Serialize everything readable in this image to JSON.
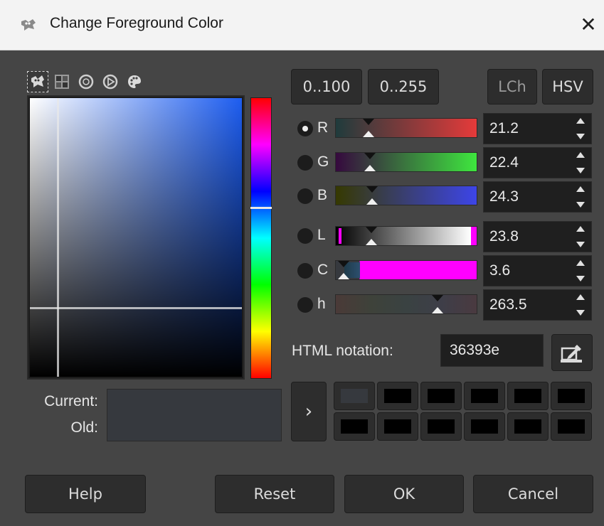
{
  "window": {
    "title": "Change Foreground Color",
    "close_symbol": "✕"
  },
  "selector_tabs": [
    {
      "icon": "gimp-wilber-icon",
      "active": true
    },
    {
      "icon": "cmyk-grid-icon",
      "active": false
    },
    {
      "icon": "color-wheel-icon",
      "active": false
    },
    {
      "icon": "triangle-wheel-icon",
      "active": false
    },
    {
      "icon": "palette-icon",
      "active": false
    }
  ],
  "range_buttons": {
    "r100": "0..100",
    "r255": "0..255"
  },
  "mode_buttons": {
    "lch": "LCh",
    "hsv": "HSV"
  },
  "channels": [
    {
      "key": "R",
      "value": "21.2",
      "selected": true,
      "fraction": 0.212,
      "color": "#e53a3a"
    },
    {
      "key": "G",
      "value": "22.4",
      "selected": false,
      "fraction": 0.224,
      "color": "#3ee63e"
    },
    {
      "key": "B",
      "value": "24.3",
      "selected": false,
      "fraction": 0.243,
      "color": "#3d45e8"
    },
    {
      "key": "L",
      "value": "23.8",
      "selected": false,
      "fraction": 0.238,
      "color": "#ffffff"
    },
    {
      "key": "C",
      "value": "3.6",
      "selected": false,
      "fraction": 0.036,
      "color": "#ff00ff"
    },
    {
      "key": "h",
      "value": "263.5",
      "selected": false,
      "fraction": 0.732,
      "color": "#5a4a4a"
    }
  ],
  "html_notation": {
    "label": "HTML notation:",
    "value": "36393e"
  },
  "eyedropper_icon": "eyedropper-icon",
  "preview": {
    "current_label": "Current:",
    "old_label": "Old:",
    "current_color": "#36393e"
  },
  "history_arrow": "›",
  "history_colors": [
    "#36393e",
    "#000000",
    "#000000",
    "#000000",
    "#000000",
    "#000000",
    "#000000",
    "#000000",
    "#000000",
    "#000000",
    "#000000",
    "#000000"
  ],
  "footer": {
    "help": "Help",
    "reset": "Reset",
    "ok": "OK",
    "cancel": "Cancel"
  }
}
